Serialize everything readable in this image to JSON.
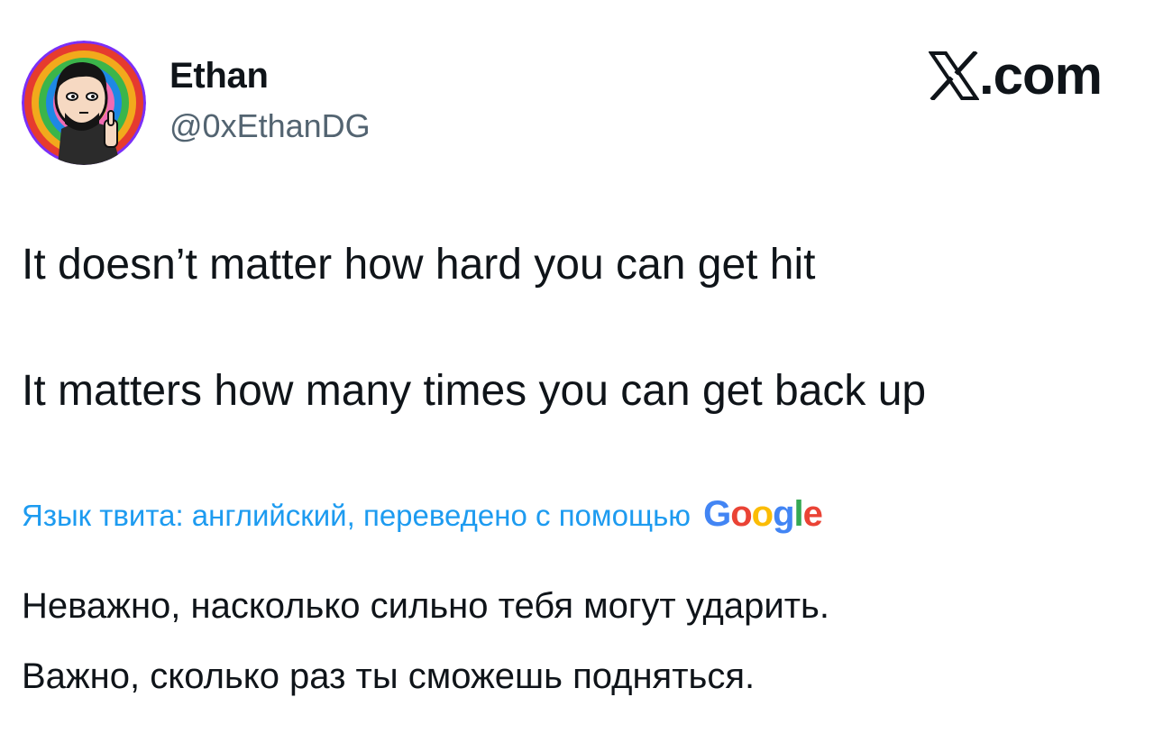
{
  "author": {
    "display_name": "Ethan",
    "handle": "@0xEthanDG",
    "avatar_icon": "cartoon-avatar-icon"
  },
  "brand": {
    "text": ".com",
    "icon": "x-logo-icon"
  },
  "tweet": {
    "lines": [
      "It doesn’t matter how hard you can get hit",
      "It matters how many times you can get back up"
    ]
  },
  "translation": {
    "label": "Язык твита: английский, переведено с помощью",
    "provider_letters": [
      "G",
      "o",
      "o",
      "g",
      "l",
      "e"
    ],
    "provider_colors": [
      "#4285f4",
      "#ea4335",
      "#fbbc05",
      "#4285f4",
      "#34a853",
      "#ea4335"
    ],
    "lines": [
      "Неважно, насколько сильно тебя могут ударить.",
      "Важно, сколько раз ты сможешь подняться."
    ]
  },
  "colors": {
    "text": "#0f1419",
    "secondary": "#536471",
    "accent": "#1d9bf0"
  }
}
